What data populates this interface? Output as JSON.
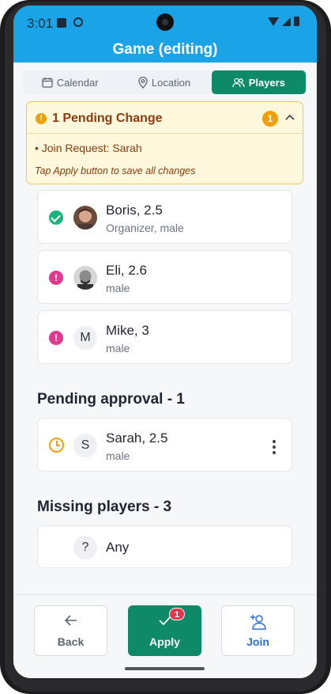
{
  "status_bar": {
    "time": "3:01"
  },
  "header": {
    "title": "Game (editing)"
  },
  "tabs": [
    {
      "label": "Calendar",
      "icon": "calendar-icon",
      "active": false
    },
    {
      "label": "Location",
      "icon": "location-pin-icon",
      "active": false
    },
    {
      "label": "Players",
      "icon": "players-icon",
      "active": true
    }
  ],
  "pending_changes": {
    "title": "1 Pending Change",
    "count": "1",
    "items": [
      "• Join Request: Sarah"
    ],
    "hint": "Tap Apply button to save all changes"
  },
  "players": [
    {
      "name": "Boris, 2.5",
      "subtitle": "Organizer, male",
      "status": "confirmed",
      "avatar": "photo"
    },
    {
      "name": "Eli, 2.6",
      "subtitle": "male",
      "status": "warning",
      "avatar": "photo"
    },
    {
      "name": "Mike, 3",
      "subtitle": "male",
      "status": "warning",
      "avatar_letter": "M"
    }
  ],
  "pending_approval": {
    "title": "Pending approval - 1",
    "players": [
      {
        "name": "Sarah, 2.5",
        "subtitle": "male",
        "status": "pending",
        "avatar_letter": "S"
      }
    ]
  },
  "missing_players": {
    "title": "Missing players - 3",
    "slots": [
      {
        "name": "Any",
        "avatar_letter": "?"
      }
    ]
  },
  "bottom_bar": {
    "back_label": "Back",
    "apply_label": "Apply",
    "apply_badge": "1",
    "join_label": "Join"
  },
  "colors": {
    "header": "#1ba3e8",
    "accent_green": "#0f8a68",
    "warning_orange": "#f0a00a",
    "alert_pink": "#e0398f",
    "join_blue": "#2a6fe0",
    "badge_red": "#e6364d"
  }
}
